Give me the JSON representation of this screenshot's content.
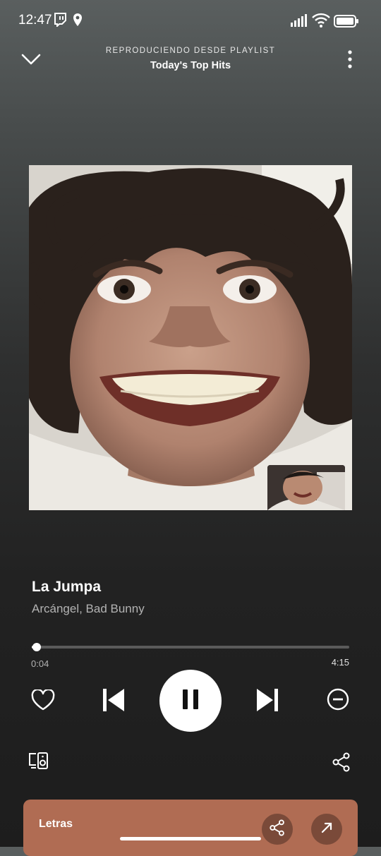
{
  "status_bar": {
    "time": "12:47",
    "icons": [
      "twitch-icon",
      "location-icon",
      "signal-icon",
      "wifi-icon",
      "battery-icon"
    ]
  },
  "header": {
    "context_label": "REPRODUCIENDO DESDE PLAYLIST",
    "playlist_name": "Today's Top Hits",
    "icons": [
      "chevron-down-icon",
      "more-vertical-icon"
    ]
  },
  "album_art": {
    "icons": [
      "album-cover-photo",
      "picture-in-picture-thumbnail"
    ]
  },
  "track": {
    "title": "La Jumpa",
    "artist": "Arcángel, Bad Bunny"
  },
  "progress": {
    "elapsed": "0:04",
    "total": "4:15",
    "fraction": 0.016
  },
  "controls": {
    "icons": [
      "heart-icon",
      "skip-previous-icon",
      "pause-icon",
      "skip-next-icon",
      "minus-circle-icon"
    ],
    "play_state": "playing"
  },
  "footer_actions": {
    "icons": [
      "connect-device-icon",
      "share-icon"
    ]
  },
  "lyrics": {
    "label": "Letras",
    "icons": [
      "share-icon",
      "expand-icon"
    ]
  },
  "colors": {
    "lyrics_card": "#b06c53",
    "accent": "#ffffff",
    "secondary_text": "#b3b3b3"
  }
}
